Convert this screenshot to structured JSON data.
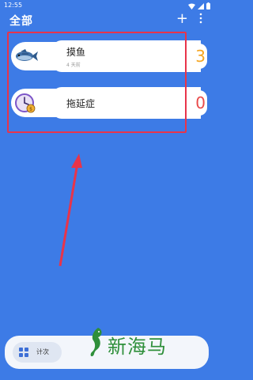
{
  "status_bar": {
    "time": "12:55"
  },
  "header": {
    "title": "全部",
    "add_label": "+",
    "icons": [
      "add-icon",
      "more-vert-icon"
    ]
  },
  "counters": [
    {
      "title": "摸鱼",
      "subtitle": "4 天前",
      "count": "3",
      "icon": "fish-icon",
      "count_color": "#f5a623"
    },
    {
      "title": "拖延症",
      "subtitle": "",
      "count": "0",
      "icon": "clock-icon",
      "count_color": "#e94b4b"
    }
  ],
  "bottom_bar": {
    "tally_label": "计次",
    "tally_icon": "grid-icon"
  },
  "watermark": {
    "text": "新海马"
  },
  "colors": {
    "background": "#3d7be6",
    "highlight": "#e8344a",
    "card": "#ffffff"
  }
}
